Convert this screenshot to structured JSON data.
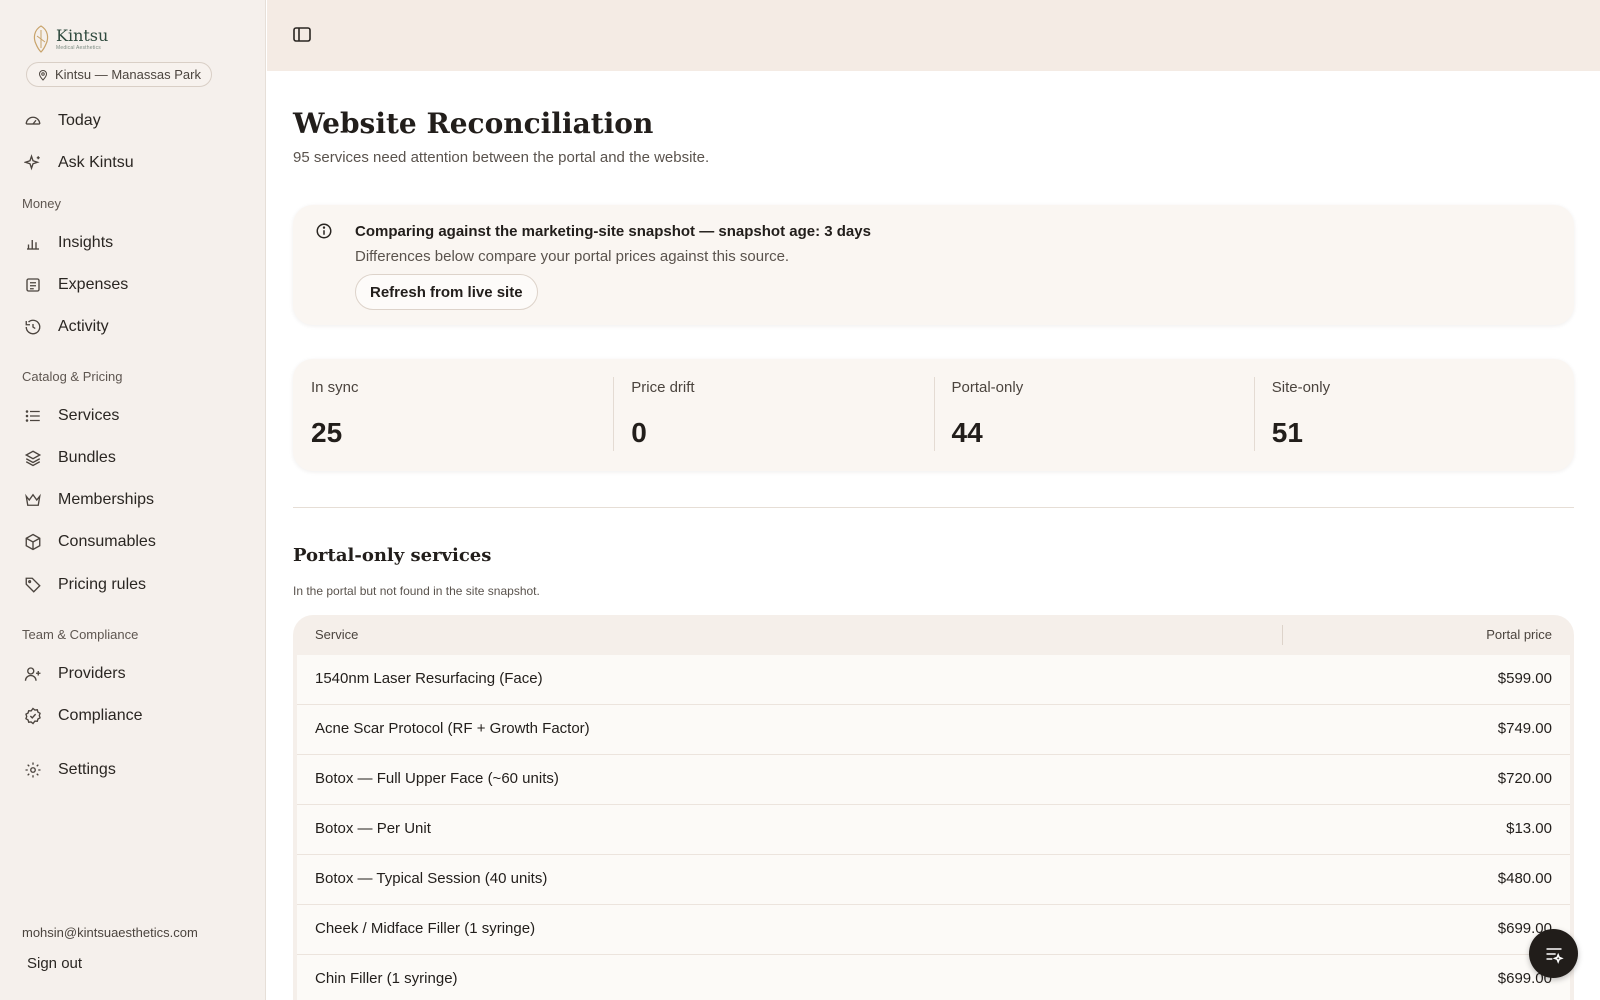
{
  "brand": {
    "name": "Kintsu",
    "tagline": "Medical Aesthetics",
    "location": "Kintsu — Manassas Park"
  },
  "sidebar": {
    "top_items": [
      {
        "label": "Today",
        "icon": "gauge-icon"
      },
      {
        "label": "Ask Kintsu",
        "icon": "sparkle-icon"
      }
    ],
    "groups": [
      {
        "label": "Money",
        "items": [
          {
            "label": "Insights",
            "icon": "bar-chart-icon"
          },
          {
            "label": "Expenses",
            "icon": "receipt-icon"
          },
          {
            "label": "Activity",
            "icon": "history-icon"
          }
        ]
      },
      {
        "label": "Catalog & Pricing",
        "items": [
          {
            "label": "Services",
            "icon": "list-icon"
          },
          {
            "label": "Bundles",
            "icon": "layers-icon"
          },
          {
            "label": "Memberships",
            "icon": "crown-icon"
          },
          {
            "label": "Consumables",
            "icon": "box-icon"
          },
          {
            "label": "Pricing rules",
            "icon": "tag-icon"
          }
        ]
      },
      {
        "label": "Team & Compliance",
        "items": [
          {
            "label": "Providers",
            "icon": "user-plus-icon"
          },
          {
            "label": "Compliance",
            "icon": "badge-check-icon"
          }
        ]
      }
    ],
    "settings": {
      "label": "Settings",
      "icon": "gear-icon"
    },
    "user_email": "mohsin@kintsuaesthetics.com",
    "sign_out": "Sign out"
  },
  "page": {
    "title": "Website Reconciliation",
    "subtitle": "95 services need attention between the portal and the website."
  },
  "notice": {
    "title": "Comparing against the marketing-site snapshot — snapshot age: 3 days",
    "description": "Differences below compare your portal prices against this source.",
    "button": "Refresh from live site"
  },
  "stats": [
    {
      "label": "In sync",
      "value": "25"
    },
    {
      "label": "Price drift",
      "value": "0"
    },
    {
      "label": "Portal-only",
      "value": "44"
    },
    {
      "label": "Site-only",
      "value": "51"
    }
  ],
  "section": {
    "title": "Portal-only services",
    "subtitle": "In the portal but not found in the site snapshot."
  },
  "table": {
    "columns": [
      "Service",
      "Portal price"
    ],
    "rows": [
      {
        "service": "1540nm Laser Resurfacing (Face)",
        "price": "$599.00"
      },
      {
        "service": "Acne Scar Protocol (RF + Growth Factor)",
        "price": "$749.00"
      },
      {
        "service": "Botox — Full Upper Face (~60 units)",
        "price": "$720.00"
      },
      {
        "service": "Botox — Per Unit",
        "price": "$13.00"
      },
      {
        "service": "Botox — Typical Session (40 units)",
        "price": "$480.00"
      },
      {
        "service": "Cheek / Midface Filler (1 syringe)",
        "price": "$699.00"
      },
      {
        "service": "Chin Filler (1 syringe)",
        "price": "$699.00"
      }
    ]
  },
  "colors": {
    "sidebar_bg": "#f5f0ec",
    "topbar_bg": "#f4ebe4",
    "card_bg": "#faf6f2",
    "brand_green": "#2f4a3e",
    "fab_bg": "#211d1a"
  }
}
